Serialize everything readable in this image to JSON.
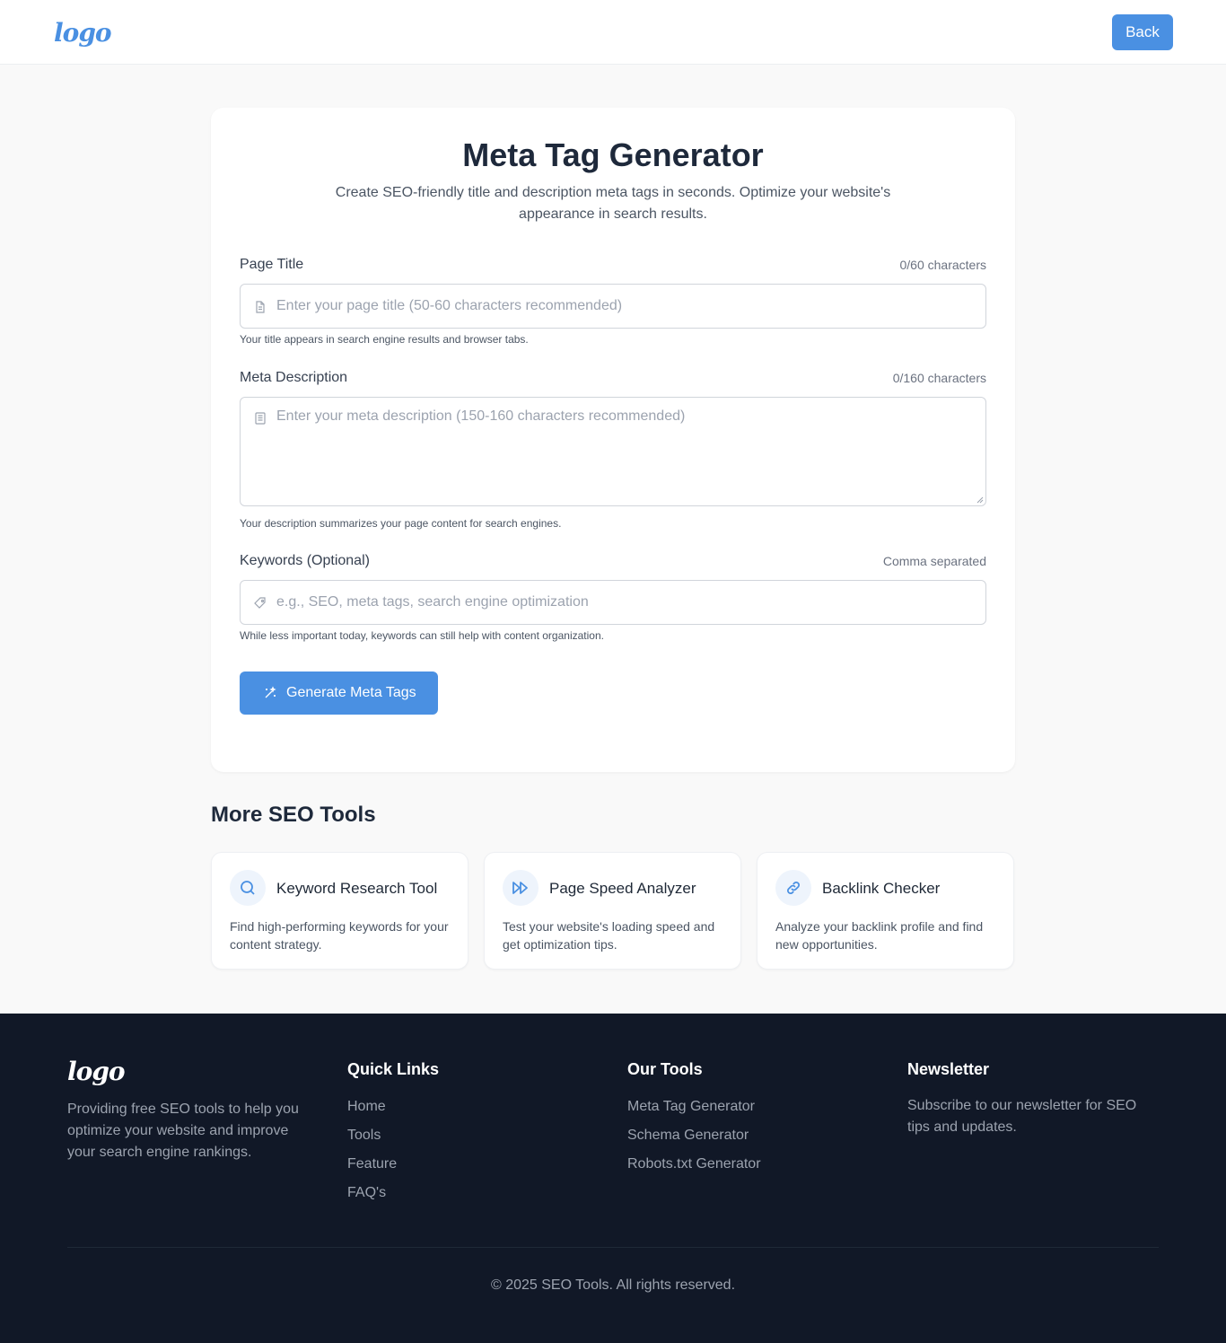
{
  "header": {
    "logo": "logo",
    "back_label": "Back"
  },
  "main": {
    "title": "Meta Tag Generator",
    "subtitle": "Create SEO-friendly title and description meta tags in seconds. Optimize your website's appearance in search results.",
    "page_title": {
      "label": "Page Title",
      "count": "0/60 characters",
      "value": "",
      "placeholder": "Enter your page title (50-60 characters recommended)",
      "hint": "Your title appears in search engine results and browser tabs.",
      "icon": "document-icon"
    },
    "meta_description": {
      "label": "Meta Description",
      "count": "0/160 characters",
      "value": "",
      "placeholder": "Enter your meta description (150-160 characters recommended)",
      "hint": "Your description summarizes your page content for search engines.",
      "icon": "text-lines-icon"
    },
    "keywords": {
      "label": "Keywords (Optional)",
      "count": "Comma separated",
      "value": "",
      "placeholder": "e.g., SEO, meta tags, search engine optimization",
      "hint": "While less important today, keywords can still help with content organization.",
      "icon": "tag-icon"
    },
    "generate_label": "Generate Meta Tags",
    "generate_icon": "magic-wand-icon"
  },
  "more_tools": {
    "title": "More SEO Tools",
    "items": [
      {
        "name": "Keyword Research Tool",
        "desc": "Find high-performing keywords for your content strategy.",
        "icon": "search-icon"
      },
      {
        "name": "Page Speed Analyzer",
        "desc": "Test your website's loading speed and get optimization tips.",
        "icon": "fast-forward-icon"
      },
      {
        "name": "Backlink Checker",
        "desc": "Analyze your backlink profile and find new opportunities.",
        "icon": "link-icon"
      }
    ]
  },
  "footer": {
    "logo": "logo",
    "desc": "Providing free SEO tools to help you optimize your website and improve your search engine rankings.",
    "quick_links": {
      "title": "Quick Links",
      "items": [
        "Home",
        "Tools",
        "Feature",
        "FAQ's"
      ]
    },
    "our_tools": {
      "title": "Our Tools",
      "items": [
        "Meta Tag Generator",
        "Schema Generator",
        "Robots.txt Generator"
      ]
    },
    "newsletter": {
      "title": "Newsletter",
      "desc": "Subscribe to our newsletter for SEO tips and updates."
    },
    "copyright": "© 2025 SEO Tools. All rights reserved."
  },
  "colors": {
    "accent": "#4a90e2",
    "footer_bg": "#111827",
    "page_bg": "#f9f9f9",
    "heading": "#1e293b"
  }
}
